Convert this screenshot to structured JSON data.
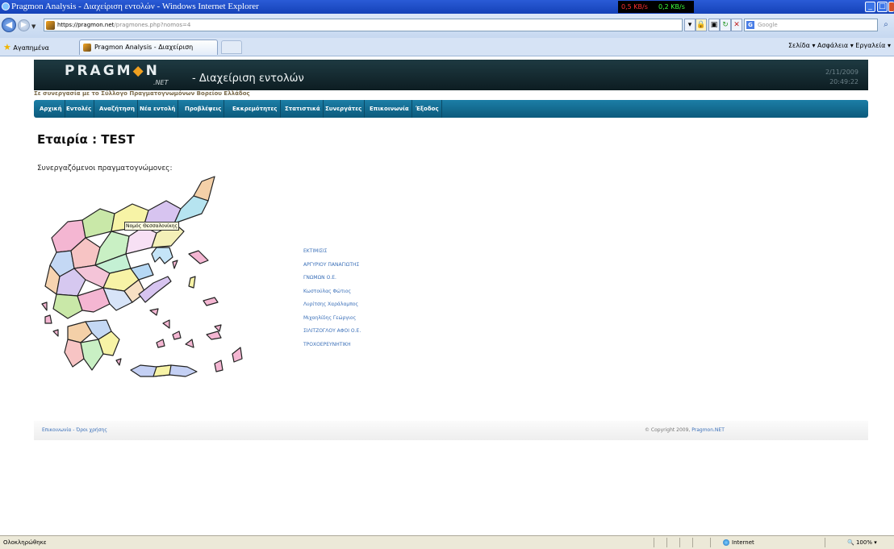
{
  "window": {
    "title": "Pragmon Analysis - Διαχείριση εντολών - Windows Internet Explorer",
    "netmon_down": "0,5 KB/s",
    "netmon_up": "0,2 KB/s"
  },
  "address_bar": {
    "url_main": "https://pragmon.net",
    "url_rest": "/pragmones.php?nomos=4",
    "search_placeholder": "Google"
  },
  "tabs_bar": {
    "favorites_label": "Αγαπημένα",
    "active_tab_label": "Pragmon Analysis - Διαχείριση εντολών",
    "command_bar": "Σελίδα ▾  Ασφάλεια ▾  Εργαλεία ▾"
  },
  "site": {
    "logo_text": "PRAGMON",
    "logo_net": ".NET",
    "app_title": "- Διαχείριση εντολών",
    "date": "2/11/2009",
    "time": "20:49:22",
    "subtitle": "Σε συνεργασία με το Σύλλογο Πραγματογνωμόνων Βορείου Ελλάδος"
  },
  "menu": [
    "Αρχική",
    "Εντολές",
    "Αναζήτηση",
    "Νέα εντολή",
    "Προβλέψεις",
    "Εκκρεμότητες",
    "Στατιστικά",
    "Συνεργάτες",
    "Επικοινωνία",
    "Έξοδος"
  ],
  "content": {
    "company_heading": "Εταιρία : TEST",
    "collaborators_label": "Συνεργαζόμενοι πραγματογνώμονες:",
    "map_tooltip": "Νομός Θεσσαλονίκης",
    "partners": [
      "ΕΚΤΙΜΙΣΙΣ",
      "ΑΡΓΥΡΙΟΥ ΠΑΝΑΓΙΩΤΗΣ",
      "ΓΝΩΜΩΝ Ο.Ε.",
      "Κωστούλας Φώτιος",
      "Λυρίτσης Χαράλαμπος",
      "Μιχαηλίδης Γεώργιος",
      "ΣΙΛΙΤΖΟΓΛΟΥ ΑΦΟΙ Ο.Ε.",
      "ΤΡΟΧΟΕΡΕΥΝΗΤΙΚΗ"
    ]
  },
  "footer": {
    "links": "Επικοινωνία - Όροι χρήσης",
    "copyright": "© Copyright 2009,",
    "copyright_link": "Pragmon.NET"
  },
  "statusbar": {
    "status": "Ολοκληρώθηκε",
    "zone": "Internet",
    "zoom": "100%"
  }
}
